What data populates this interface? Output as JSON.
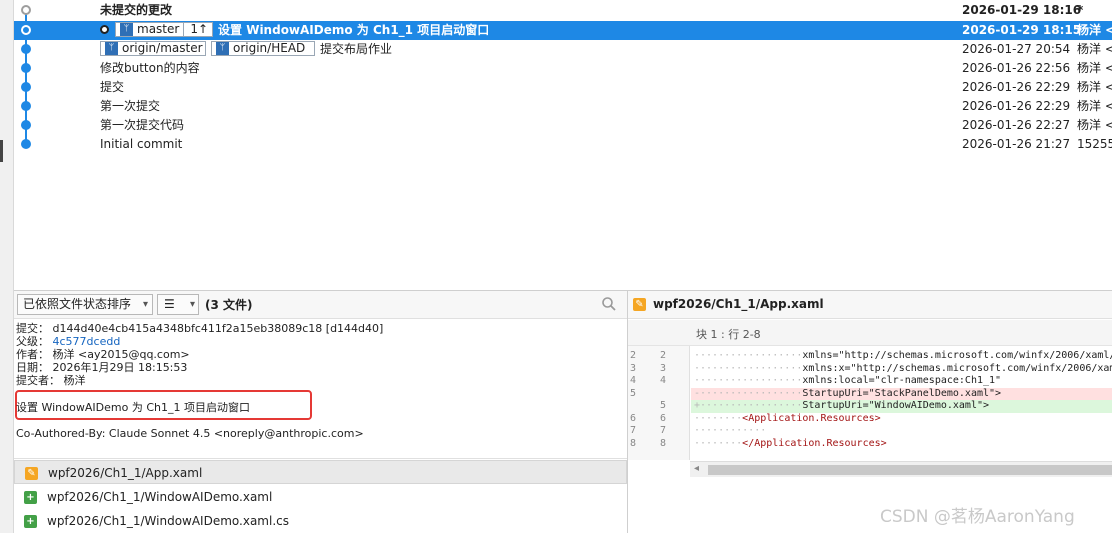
{
  "history": {
    "rows": [
      {
        "msg": "未提交的更改",
        "date": "2026-01-29 18:16",
        "author": "*"
      },
      {
        "msg": "设置 WindowAIDemo 为 Ch1_1 项目启动窗口",
        "date": "2026-01-29 18:15",
        "author": "杨洋 <"
      },
      {
        "msg": "提交布局作业",
        "date": "2026-01-27 20:54",
        "author": "杨洋 <"
      },
      {
        "msg": "修改button的内容",
        "date": "2026-01-26 22:56",
        "author": "杨洋 <"
      },
      {
        "msg": "提交",
        "date": "2026-01-26 22:29",
        "author": "杨洋 <"
      },
      {
        "msg": "第一次提交",
        "date": "2026-01-26 22:29",
        "author": "杨洋 <"
      },
      {
        "msg": "第一次提交代码",
        "date": "2026-01-26 22:27",
        "author": "杨洋 <"
      },
      {
        "msg": "Initial commit",
        "date": "2026-01-26 21:27",
        "author": "15255"
      }
    ],
    "tags": {
      "master": "master",
      "master_count": "1↑",
      "origin_master": "origin/master",
      "origin_head": "origin/HEAD"
    }
  },
  "toolbar": {
    "sort": "已依照文件状态排序",
    "view": "☰",
    "file_count": "(3 文件)"
  },
  "details": {
    "commit_label": "提交：",
    "commit_value": "d144d40e4cb415a4348bfc411f2a15eb38089c18 [d144d40]",
    "parent_label": "父级：",
    "parent_value": "4c577dcedd",
    "author_label": "作者：",
    "author_value": "杨洋 <ay2015@qq.com>",
    "date_label": "日期：",
    "date_value": "2026年1月29日 18:15:53",
    "committer_label": "提交者：",
    "committer_value": "杨洋",
    "subject": "设置 WindowAIDemo 为 Ch1_1 项目启动窗口",
    "coauthored": "Co-Authored-By: Claude Sonnet 4.5 <noreply@anthropic.com>"
  },
  "files": [
    {
      "name": "wpf2026/Ch1_1/App.xaml",
      "status": "modified"
    },
    {
      "name": "wpf2026/Ch1_1/WindowAIDemo.xaml",
      "status": "added"
    },
    {
      "name": "wpf2026/Ch1_1/WindowAIDemo.xaml.cs",
      "status": "added"
    }
  ],
  "diff": {
    "title": "wpf2026/Ch1_1/App.xaml",
    "hunk": "块 1 : 行 2-8",
    "lines": [
      {
        "o": "2",
        "n": "2",
        "t": "ctx",
        "pre": "··················",
        "code": "xmlns=\"http://schemas.microsoft.com/winfx/2006/xaml/pr"
      },
      {
        "o": "3",
        "n": "3",
        "t": "ctx",
        "pre": "··················",
        "code": "xmlns:x=\"http://schemas.microsoft.com/winfx/2006/xaml\""
      },
      {
        "o": "4",
        "n": "4",
        "t": "ctx",
        "pre": "··················",
        "code": "xmlns:local=\"clr-namespace:Ch1_1\""
      },
      {
        "o": "5",
        "n": "",
        "t": "del",
        "pre": "-·················",
        "code": "StartupUri=\"StackPanelDemo.xaml\">"
      },
      {
        "o": "",
        "n": "5",
        "t": "add",
        "pre": "+·················",
        "code": "StartupUri=\"WindowAIDemo.xaml\">"
      },
      {
        "o": "6",
        "n": "6",
        "t": "ctx",
        "pre": "········",
        "code": "<Application.Resources>"
      },
      {
        "o": "7",
        "n": "7",
        "t": "ctx",
        "pre": "············",
        "code": ""
      },
      {
        "o": "8",
        "n": "8",
        "t": "ctx",
        "pre": "········",
        "code": "</Application.Resources>"
      }
    ]
  },
  "watermark": "CSDN @茗杨AaronYang"
}
